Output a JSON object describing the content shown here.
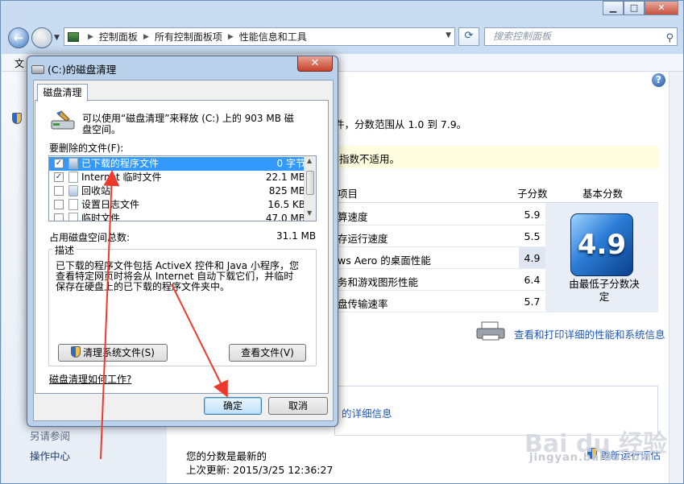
{
  "window": {
    "controls": {
      "minimize": "▁",
      "maximize": "□",
      "close": "✕"
    },
    "breadcrumb": [
      "控制面板",
      "所有控制面板项",
      "性能信息和工具"
    ],
    "search_placeholder": "搜索控制面板",
    "menu_first": "文"
  },
  "main": {
    "score_note": "件，分数范围从 1.0 到 7.9。",
    "warning": "指数不适用。",
    "col_item": "项目",
    "col_subscore": "子分数",
    "col_base": "基本分数",
    "rows": [
      {
        "label": "算速度",
        "score": "5.9",
        "highlight": false
      },
      {
        "label": "存运行速度",
        "score": "5.5",
        "highlight": false
      },
      {
        "label": "ws Aero 的桌面性能",
        "score": "4.9",
        "highlight": true
      },
      {
        "label": "务和游戏图形性能",
        "score": "6.4",
        "highlight": false
      },
      {
        "label": "盘传输速率",
        "score": "5.7",
        "highlight": false
      }
    ],
    "base_score": "4.9",
    "base_caption": "由最低子分数决定",
    "print_link": "查看和打印详细的性能和系统信息",
    "group_link": "的详细信息",
    "score_status": "您的分数是最新的",
    "last_update": "上次更新: 2015/3/25 12:36:27",
    "rerun_link": "重新运行评估"
  },
  "sidebar": {
    "see_also": "另请参阅",
    "action_center": "操作中心"
  },
  "dialog": {
    "title": "(C:)的磁盘清理",
    "close": "✕",
    "tab": "磁盘清理",
    "intro_line1": "可以使用“磁盘清理”来释放 (C:) 上的 903 MB 磁",
    "intro_line2": "盘空间。",
    "files_label": "要删除的文件(F):",
    "files": [
      {
        "name": "已下载的程序文件",
        "size": "0 字节",
        "checked": true,
        "selected": true
      },
      {
        "name": "Internet 临时文件",
        "size": "22.1 MB",
        "checked": true,
        "selected": false
      },
      {
        "name": "回收站",
        "size": "825 MB",
        "checked": false,
        "selected": false
      },
      {
        "name": "设置日志文件",
        "size": "16.5 KB",
        "checked": false,
        "selected": false
      },
      {
        "name": "临时文件",
        "size": "47.0 MB",
        "checked": false,
        "selected": false
      }
    ],
    "total_label": "占用磁盘空间总数:",
    "total_value": "31.1 MB",
    "desc_label": "描述",
    "desc_line1": "已下载的程序文件包括 ActiveX 控件和 Java 小程序，您",
    "desc_line2": "查看特定网页时将会从 Internet 自动下载它们，并临时",
    "desc_line3": "保存在硬盘上的已下载的程序文件夹中。",
    "clean_system_button": "清理系统文件(S)",
    "view_files_button": "查看文件(V)",
    "how_link": "磁盘清理如何工作?",
    "ok_button": "确定",
    "cancel_button": "取消"
  },
  "watermark": {
    "brand": "Bai du 经验",
    "sub": "jingyan.baidu.com"
  },
  "colors": {
    "selection": "#3399ff",
    "link": "#1d56b4",
    "annotation_arrow": "#ee3a2e"
  }
}
